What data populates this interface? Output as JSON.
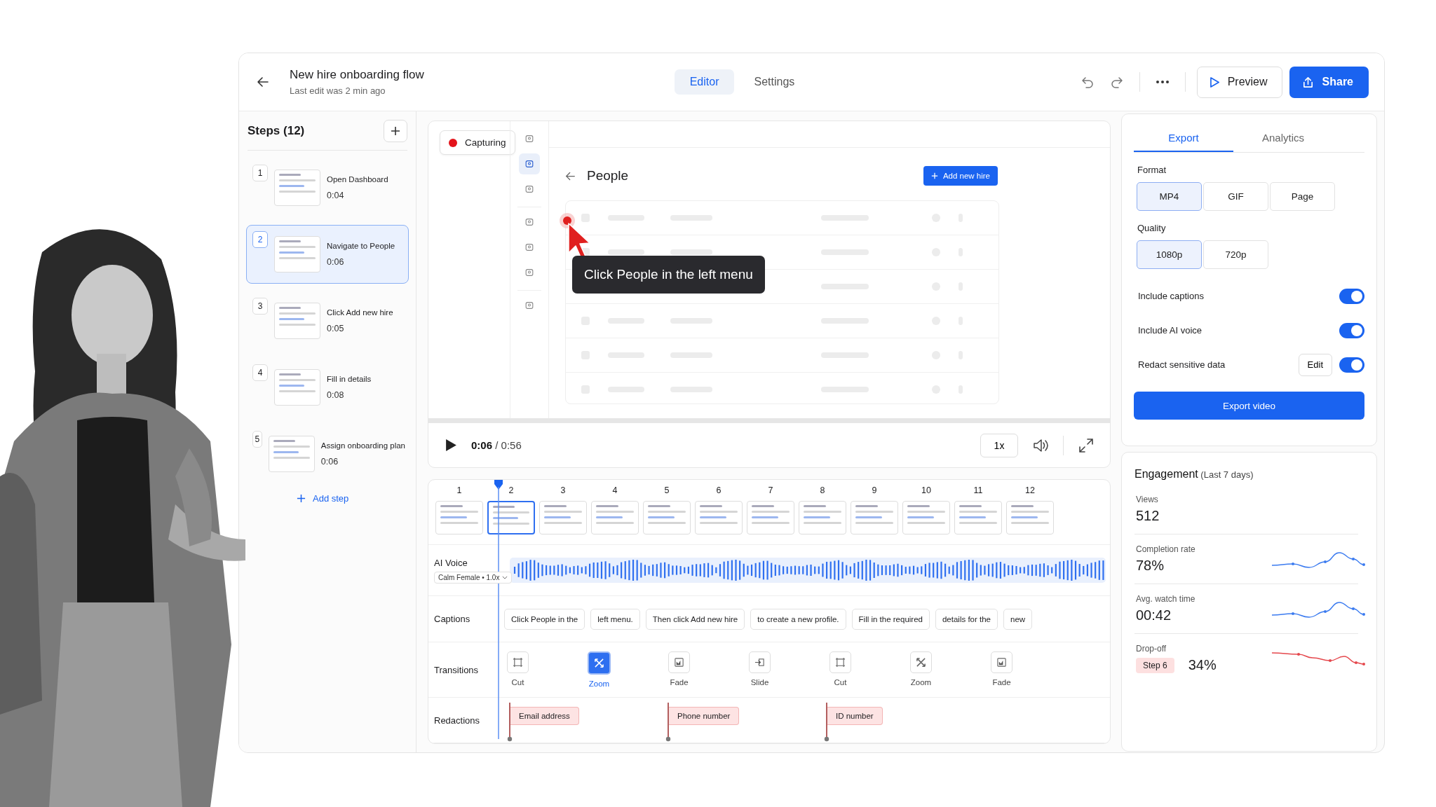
{
  "header": {
    "title": "New hire onboarding flow",
    "subtitle": "Last edit was 2 min ago",
    "tabs": [
      {
        "label": "Editor",
        "selected": true
      },
      {
        "label": "Settings",
        "selected": false
      }
    ],
    "preview": "Preview",
    "share": "Share"
  },
  "steps": {
    "title": "Steps (12)",
    "items": [
      {
        "number": "1",
        "title": "Open Dashboard",
        "duration": "0:04",
        "selected": false
      },
      {
        "number": "2",
        "title": "Navigate to People",
        "duration": "0:06",
        "selected": true
      },
      {
        "number": "3",
        "title": "Click Add new hire",
        "duration": "0:05",
        "selected": false
      },
      {
        "number": "4",
        "title": "Fill in details",
        "duration": "0:08",
        "selected": false
      },
      {
        "number": "5",
        "title": "Assign onboarding plan",
        "duration": "0:06",
        "selected": false
      }
    ],
    "add": "Add step"
  },
  "recorder": {
    "status": "Capturing",
    "nav_groups": [
      {
        "items": [
          {
            "selected": false
          },
          {
            "selected": true
          },
          {
            "selected": false
          }
        ]
      },
      {
        "items": [
          {
            "selected": false
          },
          {
            "selected": false
          },
          {
            "selected": false
          }
        ]
      },
      {
        "items": [
          {
            "selected": false
          }
        ]
      }
    ],
    "screen_title": "People",
    "primary_button": "Add new hire",
    "tooltip": "Click People in the left menu"
  },
  "player": {
    "current": "0:06",
    "total": "/ 0:56",
    "speed": "1x"
  },
  "timeline": {
    "steps": [
      {
        "number": "1",
        "selected": false
      },
      {
        "number": "2",
        "selected": true
      },
      {
        "number": "3",
        "selected": false
      },
      {
        "number": "4",
        "selected": false
      },
      {
        "number": "5",
        "selected": false
      },
      {
        "number": "6",
        "selected": false
      },
      {
        "number": "7",
        "selected": false
      },
      {
        "number": "8",
        "selected": false
      },
      {
        "number": "9",
        "selected": false
      },
      {
        "number": "10",
        "selected": false
      },
      {
        "number": "11",
        "selected": false
      },
      {
        "number": "12",
        "selected": false
      }
    ],
    "voice": {
      "label": "AI Voice",
      "voice": "Calm Female • 1.0x"
    },
    "captions": {
      "label": "Captions",
      "items": [
        "Click People in the",
        "left menu.",
        "Then click Add new hire",
        "to create a new profile.",
        "Fill in the required",
        "details for the",
        "new"
      ]
    },
    "transitions": {
      "label": "Transitions",
      "items": [
        {
          "label": "Cut",
          "kind": "cut",
          "selected": false
        },
        {
          "label": "Zoom",
          "kind": "zoom",
          "selected": true
        },
        {
          "label": "Fade",
          "kind": "fade",
          "selected": false
        },
        {
          "label": "Slide",
          "kind": "slide",
          "selected": false
        },
        {
          "label": "Cut",
          "kind": "cut",
          "selected": false
        },
        {
          "label": "Zoom",
          "kind": "zoom",
          "selected": false
        },
        {
          "label": "Fade",
          "kind": "fade",
          "selected": false
        }
      ]
    },
    "redactions": {
      "label": "Redactions",
      "items": [
        "Email address",
        "Phone number",
        "ID number"
      ]
    }
  },
  "export": {
    "tabs": [
      {
        "label": "Export",
        "selected": true
      },
      {
        "label": "Analytics",
        "selected": false
      }
    ],
    "format": {
      "label": "Format",
      "options": [
        {
          "label": "MP4",
          "selected": true
        },
        {
          "label": "GIF",
          "selected": false
        },
        {
          "label": "Page",
          "selected": false
        }
      ]
    },
    "quality": {
      "label": "Quality",
      "options": [
        {
          "label": "1080p",
          "selected": true
        },
        {
          "label": "720p",
          "selected": false
        }
      ]
    },
    "toggles": [
      {
        "label": "Include captions",
        "on": true
      },
      {
        "label": "Include AI voice",
        "on": true
      },
      {
        "label": "Redact sensitive data",
        "on": true,
        "action": "Edit"
      }
    ],
    "button": "Export video"
  },
  "engagement": {
    "title": "**Engagement** (Last 7 days)",
    "metrics": [
      {
        "label": "Views",
        "value": "512"
      },
      {
        "label": "Completion rate",
        "value": "78%",
        "color": "#3b7bf0"
      },
      {
        "label": "Avg. watch time",
        "value": "00:42",
        "color": "#3b7bf0"
      },
      {
        "label": "Drop-off",
        "badge": "Step 6",
        "value": "34%",
        "color": "#e5484d"
      }
    ]
  }
}
